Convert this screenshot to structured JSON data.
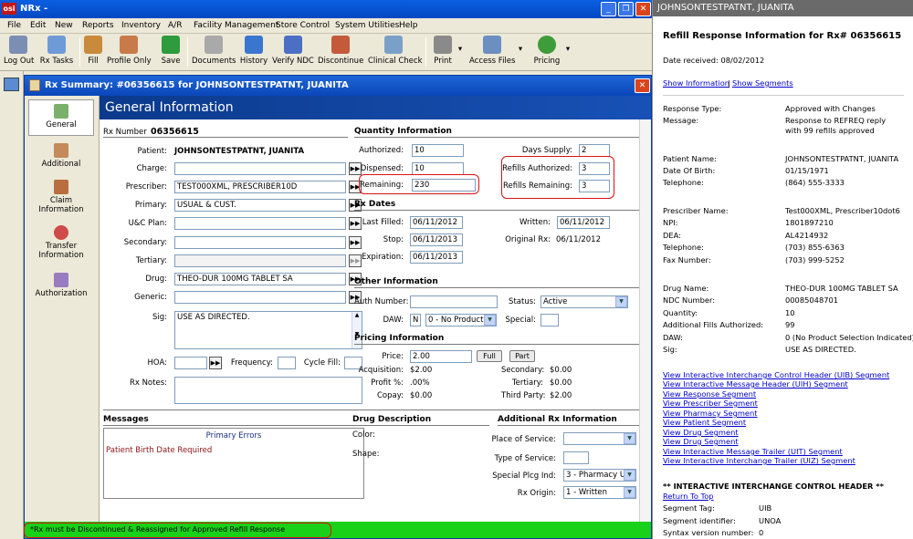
{
  "window": {
    "title": "NRx -",
    "logo": "osi"
  },
  "menu": [
    "File",
    "Edit",
    "New",
    "Reports",
    "Inventory",
    "A/R",
    "Facility Management",
    "Store Control",
    "System Utilities",
    "Help"
  ],
  "toolbar": {
    "log_out": "Log Out",
    "rx_tasks": "Rx Tasks",
    "fill": "Fill",
    "profile_only": "Profile Only",
    "save": "Save",
    "documents": "Documents",
    "history": "History",
    "verify_ndc": "Verify NDC",
    "discontinue": "Discontinue",
    "clinical_check": "Clinical Check",
    "print": "Print",
    "access_files": "Access Files",
    "pricing": "Pricing"
  },
  "child": {
    "title": "Rx Summary: #06356615 for JOHNSONTESTPATNT, JUANITA"
  },
  "nav": {
    "general": "General",
    "additional": "Additional",
    "claim_information": "Claim Information",
    "transfer_information": "Transfer Information",
    "authorization": "Authorization"
  },
  "gi": {
    "header": "General Information",
    "rx_number_label": "Rx Number",
    "rx_number": "06356615",
    "patient_label": "Patient:",
    "patient": "JOHNSONTESTPATNT, JUANITA",
    "charge_label": "Charge:",
    "charge": "",
    "prescriber_label": "Prescriber:",
    "prescriber": "TEST000XML, PRESCRIBER10D",
    "primary_label": "Primary:",
    "primary": "USUAL & CUST.",
    "uc_plan_label": "U&C Plan:",
    "uc_plan": "",
    "secondary_label": "Secondary:",
    "secondary": "",
    "tertiary_label": "Tertiary:",
    "tertiary": "",
    "drug_label": "Drug:",
    "drug": "THEO-DUR 100MG TABLET SA",
    "generic_label": "Generic:",
    "generic": "",
    "sig_label": "Sig:",
    "sig": "USE AS DIRECTED.",
    "hoa_label": "HOA:",
    "hoa": "",
    "frequency_label": "Frequency:",
    "frequency": "",
    "cycle_fill_label": "Cycle Fill:",
    "cycle_fill": "",
    "rx_notes_label": "Rx Notes:",
    "rx_notes": ""
  },
  "qty": {
    "section": "Quantity Information",
    "authorized_label": "Authorized:",
    "authorized": "10",
    "dispensed_label": "Dispensed:",
    "dispensed": "10",
    "remaining_label": "Remaining:",
    "remaining": "230",
    "days_supply_label": "Days Supply:",
    "days_supply": "2",
    "refills_authorized_label": "Refills Authorized:",
    "refills_authorized": "3",
    "refills_remaining_label": "Refills Remaining:",
    "refills_remaining": "3"
  },
  "dates": {
    "section": "Rx Dates",
    "last_filled_label": "Last Filled:",
    "last_filled": "06/11/2012",
    "written_label": "Written:",
    "written": "06/11/2012",
    "stop_label": "Stop:",
    "stop": "06/11/2013",
    "original_rx_label": "Original Rx:",
    "original_rx": "06/11/2012",
    "expiration_label": "Expiration:",
    "expiration": "06/11/2013"
  },
  "other": {
    "section": "Other Information",
    "auth_number_label": "Auth Number:",
    "auth_number": "",
    "status_label": "Status:",
    "status": "Active",
    "daw_label": "DAW:",
    "daw_flag": "N",
    "daw": "0 - No Product",
    "special_label": "Special:",
    "special": ""
  },
  "pricing": {
    "section": "Pricing Information",
    "price_label": "Price:",
    "price": "2.00",
    "full_button": "Full",
    "part_button": "Part",
    "acquisition_label": "Acquisition:",
    "acquisition": "$2.00",
    "profit_label": "Profit %:",
    "profit": ".00%",
    "copay_label": "Copay:",
    "copay": "$0.00",
    "secondary_label": "Secondary:",
    "secondary": "$0.00",
    "tertiary_label": "Tertiary:",
    "tertiary": "$0.00",
    "third_party_label": "Third Party:",
    "third_party": "$2.00"
  },
  "messages": {
    "section": "Messages",
    "header": "Primary Errors",
    "error": "Patient Birth Date Required"
  },
  "drugdesc": {
    "section": "Drug Description",
    "color_label": "Color:",
    "shape_label": "Shape:"
  },
  "addl": {
    "section": "Additional Rx Information",
    "place_label": "Place of Service:",
    "place": "",
    "type_label": "Type of Service:",
    "type": "",
    "special_plcg_label": "Special Plcg Ind:",
    "special_plcg": "3 - Pharmacy U",
    "rx_origin_label": "Rx Origin:",
    "rx_origin": "1 - Written"
  },
  "status_bar": "*Rx must be Discontinued & Reassigned for Approved Refill Response",
  "right": {
    "title": "JOHNSONTESTPATNT, JUANITA",
    "heading": "Refill Response Information for Rx# 06356615",
    "date_received": "Date received: 08/02/2012",
    "show_information": "Show Information",
    "sep": "|",
    "show_segments": "Show Segments",
    "response_type_label": "Response Type:",
    "response_type": "Approved with Changes",
    "message_label": "Message:",
    "message": "Response to REFREQ reply with 99 refills approved",
    "patient_name_label": "Patient Name:",
    "patient_name": "JOHNSONTESTPATNT, JUANITA",
    "dob_label": "Date Of Birth:",
    "dob": "01/15/1971",
    "telephone_label": "Telephone:",
    "telephone": "(864) 555-3333",
    "prescriber_name_label": "Prescriber Name:",
    "prescriber_name": "Test000XML, Prescriber10dot6",
    "npi_label": "NPI:",
    "npi": "1801897210",
    "dea_label": "DEA:",
    "dea": "AL4214932",
    "ptelephone_label": "Telephone:",
    "ptelephone": "(703) 855-6363",
    "fax_label": "Fax Number:",
    "fax": "(703) 999-5252",
    "drug_name_label": "Drug Name:",
    "drug_name": "THEO-DUR 100MG TABLET SA",
    "ndc_label": "NDC Number:",
    "ndc": "00085048701",
    "quantity_label": "Quantity:",
    "quantity": "10",
    "addl_fills_label": "Additional Fills Authorized:",
    "addl_fills": "99",
    "daw_label": "DAW:",
    "daw": "0 (No Product Selection Indicated)",
    "sig_label": "Sig:",
    "sig": "USE AS DIRECTED.",
    "links": [
      "View Interactive Interchange Control Header (UIB) Segment",
      "View Interactive Message Header (UIH) Segment",
      "View Response Segment",
      "View Prescriber Segment",
      "View Pharmacy Segment",
      "View Patient Segment",
      "View Drug Segment",
      "View Drug Segment",
      "View Interactive Message Trailer (UIT) Segment",
      "View Interactive Interchange Trailer (UIZ) Segment"
    ],
    "uib_heading": "** INTERACTIVE INTERCHANGE CONTROL HEADER **",
    "return_to_top": "Return To Top",
    "segment_tag_label": "Segment Tag:",
    "segment_tag": "UIB",
    "segment_id_label": "Segment identifier:",
    "segment_id": "UNOA",
    "syntax_label": "Syntax version number:",
    "syntax": "0"
  }
}
